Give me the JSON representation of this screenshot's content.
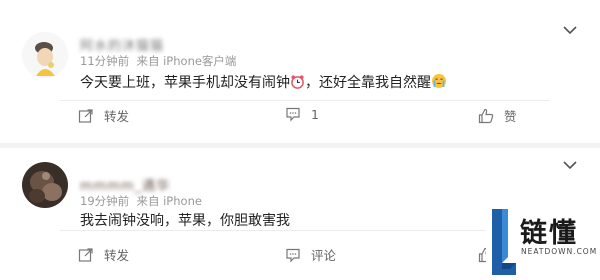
{
  "posts": [
    {
      "username": "阿水的沐猫猫",
      "time_ago": "11分钟前",
      "source": "来自 iPhone客户端",
      "content_before": "今天要上班，苹果手机却没有闹钟",
      "content_middle": "，还好全靠我自然醒",
      "actions": {
        "forward_label": "转发",
        "comment_label": "1",
        "like_label": "赞"
      }
    },
    {
      "username": "mmmm_遇华",
      "time_ago": "19分钟前",
      "source": "来自 iPhone",
      "content": "我去闹钟没响，苹果，你胆敢害我",
      "actions": {
        "forward_label": "转发",
        "comment_label": "评论",
        "like_label": "赞"
      }
    }
  ],
  "watermark": {
    "name": "链懂",
    "domain": "NEATDOWN.COM"
  },
  "colors": {
    "background": "#f3f3f3",
    "card": "#ffffff",
    "text": "#222222",
    "meta": "#999999",
    "icon": "#777777"
  }
}
